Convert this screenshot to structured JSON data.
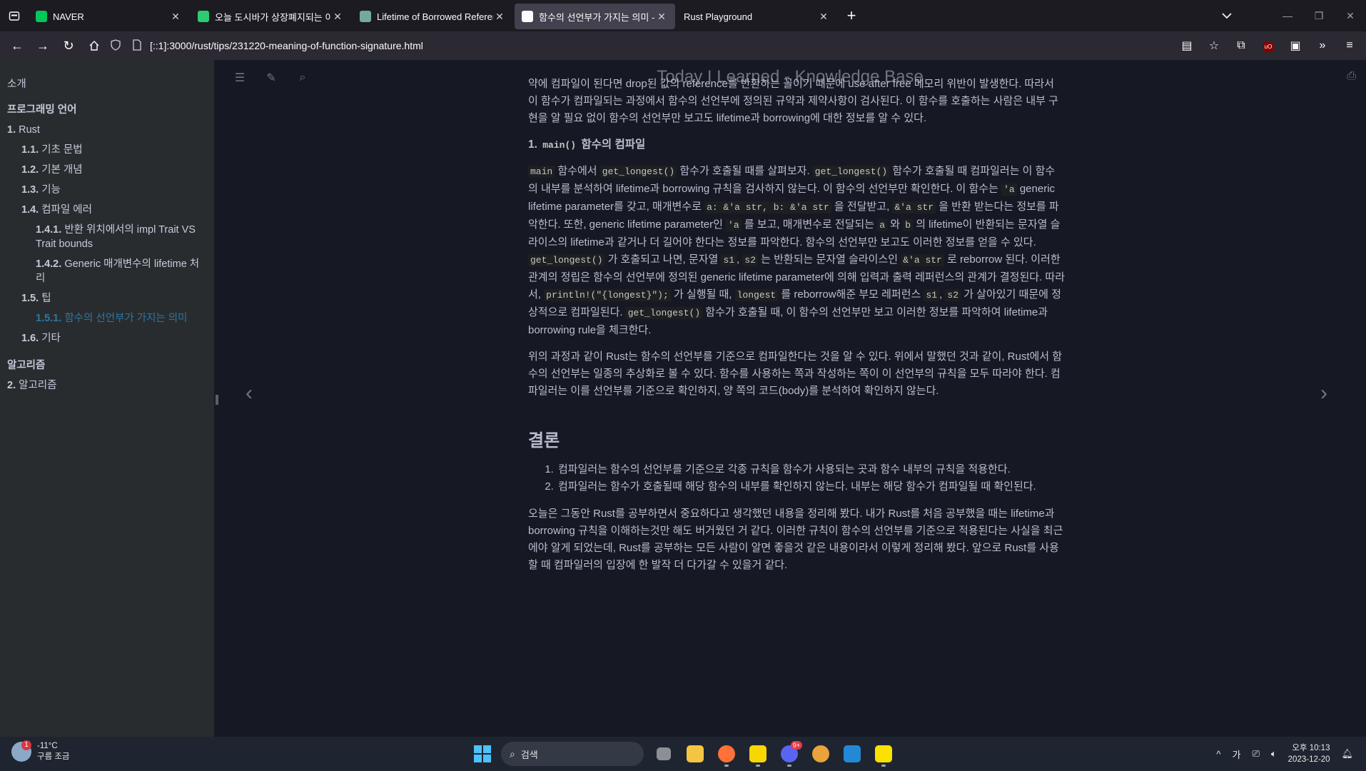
{
  "browser": {
    "tabs": [
      {
        "title": "NAVER",
        "favicon": "naver-icon",
        "color": "#03c75a",
        "active": false
      },
      {
        "title": "오늘 도시바가 상장폐지되는 이",
        "favicon": "bookmark-icon",
        "color": "#2ecc71",
        "active": false
      },
      {
        "title": "Lifetime of Borrowed Referenc",
        "favicon": "chatgpt-icon",
        "color": "#74aa9c",
        "active": false
      },
      {
        "title": "함수의 선언부가 가지는 의미 -",
        "favicon": "book-icon",
        "color": "#fbfbfe",
        "active": true
      },
      {
        "title": "Rust Playground",
        "favicon": "",
        "color": "",
        "active": false
      }
    ],
    "url": "[::1]:3000/rust/tips/231220-meaning-of-function-signature.html"
  },
  "book": {
    "title": "Today I Learned - Knowledge Base"
  },
  "sidebar": {
    "items": [
      {
        "text": "소개",
        "level": "part",
        "num": ""
      },
      {
        "text": "프로그래밍 언어",
        "level": "part-title",
        "num": ""
      },
      {
        "text": "Rust",
        "level": "l1",
        "num": "1."
      },
      {
        "text": "기초 문법",
        "level": "l2",
        "num": "1.1."
      },
      {
        "text": "기본 개념",
        "level": "l2",
        "num": "1.2."
      },
      {
        "text": "기능",
        "level": "l2",
        "num": "1.3."
      },
      {
        "text": "컴파일 에러",
        "level": "l2",
        "num": "1.4."
      },
      {
        "text": "반환 위치에서의 impl Trait VS Trait bounds",
        "level": "l3",
        "num": "1.4.1."
      },
      {
        "text": "Generic 매개변수의 lifetime 처리",
        "level": "l3",
        "num": "1.4.2."
      },
      {
        "text": "팁",
        "level": "l2",
        "num": "1.5."
      },
      {
        "text": "함수의 선언부가 가지는 의미",
        "level": "l3-active",
        "num": "1.5.1."
      },
      {
        "text": "기타",
        "level": "l2",
        "num": "1.6."
      },
      {
        "text": "알고리즘",
        "level": "part-title",
        "num": ""
      },
      {
        "text": "알고리즘",
        "level": "l1",
        "num": "2."
      }
    ]
  },
  "article": {
    "p0": "약에 컴파일이 된다면 drop된 값의 reference를 반환하는 꼴이기 때문에 use after free 메모리 위반이 발생한다. 따라서 이 함수가 컴파일되는 과정에서 함수의 선언부에 정의된 규약과 제약사항이 검사된다. 이 함수를 호출하는 사람은 내부 구현을 알 필요 없이 함수의 선언부만 보고도 lifetime과 borrowing에 대한 정보를 알 수 있다.",
    "h_num": "1.",
    "h_code": "main()",
    "h_text": "함수의 컴파일",
    "p1": [
      {
        "t": "code",
        "v": "main"
      },
      {
        "t": "text",
        "v": " 함수에서 "
      },
      {
        "t": "code",
        "v": "get_longest()"
      },
      {
        "t": "text",
        "v": " 함수가 호출될 때를 살펴보자. "
      },
      {
        "t": "code",
        "v": "get_longest()"
      },
      {
        "t": "text",
        "v": " 함수가 호출될 때 컴파일러는 이 함수의 내부를 분석하여 lifetime과 borrowing 규칙을 검사하지 않는다. 이 함수의 선언부만 확인한다. 이 함수는 "
      },
      {
        "t": "code",
        "v": "'a"
      },
      {
        "t": "text",
        "v": " generic lifetime parameter를 갖고, 매개변수로 "
      },
      {
        "t": "code",
        "v": "a: &'a str, b: &'a str"
      },
      {
        "t": "text",
        "v": " 을 전달받고, "
      },
      {
        "t": "code",
        "v": "&'a str"
      },
      {
        "t": "text",
        "v": " 을 반환 받는다는 정보를 파악한다. 또한, generic lifetime parameter인 "
      },
      {
        "t": "code",
        "v": "'a"
      },
      {
        "t": "text",
        "v": " 를 보고, 매개변수로 전달되는 "
      },
      {
        "t": "code",
        "v": "a"
      },
      {
        "t": "text",
        "v": " 와 "
      },
      {
        "t": "code",
        "v": "b"
      },
      {
        "t": "text",
        "v": " 의 lifetime이 반환되는 문자열 슬라이스의 lifetime과 같거나 더 길어야 한다는 정보를 파악한다. 함수의 선언부만 보고도 이러한 정보를 얻을 수 있다. "
      },
      {
        "t": "code",
        "v": "get_longest()"
      },
      {
        "t": "text",
        "v": " 가 호출되고 나면, 문자열 "
      },
      {
        "t": "code",
        "v": "s1"
      },
      {
        "t": "text",
        "v": ", "
      },
      {
        "t": "code",
        "v": "s2"
      },
      {
        "t": "text",
        "v": " 는 반환되는 문자열 슬라이스인 "
      },
      {
        "t": "code",
        "v": "&'a str"
      },
      {
        "t": "text",
        "v": " 로 reborrow 된다. 이러한 관계의 정립은 함수의 선언부에 정의된 generic lifetime parameter에 의해 입력과 출력 레퍼런스의 관계가 결정된다. 따라서, "
      },
      {
        "t": "code",
        "v": "println!(\"{longest}\");"
      },
      {
        "t": "text",
        "v": " 가 실행될 때, "
      },
      {
        "t": "code",
        "v": "longest"
      },
      {
        "t": "text",
        "v": " 를 reborrow해준 부모 레퍼런스 "
      },
      {
        "t": "code",
        "v": "s1"
      },
      {
        "t": "text",
        "v": ", "
      },
      {
        "t": "code",
        "v": "s2"
      },
      {
        "t": "text",
        "v": " 가 살아있기 때문에 정상적으로 컴파일된다. "
      },
      {
        "t": "code",
        "v": "get_longest()"
      },
      {
        "t": "text",
        "v": " 함수가 호출될 때, 이 함수의 선언부만 보고 이러한 정보를 파악하여 lifetime과 borrowing rule을 체크한다."
      }
    ],
    "p2": "위의 과정과 같이 Rust는 함수의 선언부를 기준으로 컴파일한다는 것을 알 수 있다. 위에서 말했던 것과 같이, Rust에서 함수의 선언부는 일종의 추상화로 볼 수 있다. 함수를 사용하는 쪽과 작성하는 쪽이 이 선언부의 규칙을 모두 따라야 한다. 컴파일러는 이를 선언부를 기준으로 확인하지, 양 쪽의 코드(body)를 분석하여 확인하지 않는다.",
    "h2": "결론",
    "conclusion": [
      "컴파일러는 함수의 선언부를 기준으로 각종 규칙을 함수가 사용되는 곳과 함수 내부의 규칙을 적용한다.",
      "컴파일러는 함수가 호출될때 해당 함수의 내부를 확인하지 않는다. 내부는 해당 함수가 컴파일될 때 확인된다."
    ],
    "p3": "오늘은 그동안 Rust를 공부하면서 중요하다고 생각했던 내용을 정리해 봤다. 내가 Rust를 처음 공부했을 때는 lifetime과 borrowing 규칙을 이해하는것만 해도 버거웠던 거 같다. 이러한 규칙이 함수의 선언부를 기준으로 적용된다는 사실을 최근에야 알게 되었는데, Rust를 공부하는 모든 사람이 알면 좋을것 같은 내용이라서 이렇게 정리해 봤다. 앞으로 Rust를 사용할 때 컴파일러의 입장에 한 발작 더 다가갈 수 있을거 같다."
  },
  "taskbar": {
    "weather_temp": "-11°C",
    "weather_desc": "구름 조금",
    "weather_badge": "1",
    "search_placeholder": "검색",
    "discord_badge": "9+",
    "ime": "가",
    "time": "오후 10:13",
    "date": "2023-12-20"
  }
}
